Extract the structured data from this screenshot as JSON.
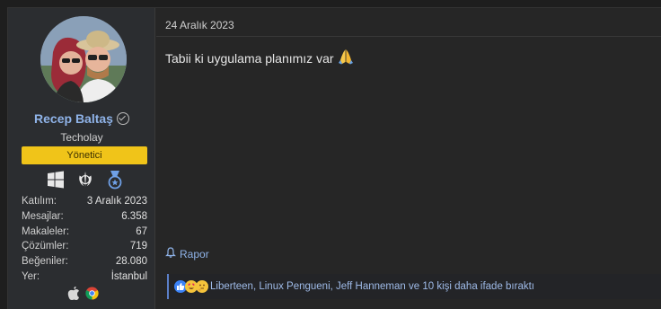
{
  "user": {
    "name": "Recep Baltaş",
    "title": "Techolay",
    "role": "Yönetici",
    "stats": [
      {
        "key": "Katılım:",
        "value": "3 Aralık 2023"
      },
      {
        "key": "Mesajlar:",
        "value": "6.358"
      },
      {
        "key": "Makaleler:",
        "value": "67"
      },
      {
        "key": "Çözümler:",
        "value": "719"
      },
      {
        "key": "Beğeniler:",
        "value": "28.080"
      },
      {
        "key": "Yer:",
        "value": "İstanbul"
      }
    ],
    "trophy_icons": [
      "windows-icon",
      "jedi-emblem-icon",
      "medal-icon"
    ],
    "os_icons": [
      "apple-icon",
      "chrome-icon"
    ]
  },
  "post": {
    "date": "24 Aralık 2023",
    "message": "Tabii ki uygulama planımız var",
    "message_emoji": "folded-hands-icon",
    "report_label": "Rapor",
    "reactions_text": "Liberteen, Linux Pengueni, Jeff Hanneman ve 10 kişi daha ifade bıraktı",
    "reaction_icons": [
      "like-icon",
      "love-eyes-icon",
      "thinking-icon"
    ]
  },
  "colors": {
    "username": "#8fb3e8",
    "role_badge": "#f0c419",
    "link": "#8fb3e8",
    "reaction_border": "#5b7fc7"
  }
}
